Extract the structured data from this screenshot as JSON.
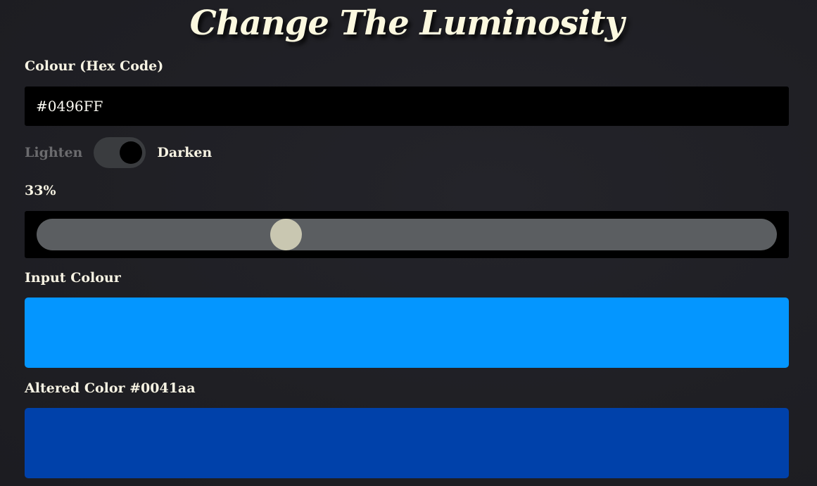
{
  "title": "Change The Luminosity",
  "hex_field": {
    "label": "Colour (Hex Code)",
    "value": "#0496FF"
  },
  "mode_toggle": {
    "left_label": "Lighten",
    "right_label": "Darken",
    "selected": "Darken"
  },
  "amount": {
    "label": "33%",
    "value_percent": 33
  },
  "input_swatch": {
    "label": "Input Colour",
    "color": "#0496FF"
  },
  "altered_swatch": {
    "label": "Altered Color #0041aa",
    "color": "#0041aa"
  },
  "colors": {
    "background": "#1f1f24",
    "text": "#f7f3e3",
    "inactive_text": "#6b6b6e",
    "slider_track": "#5b5e61",
    "slider_thumb": "#c9c7b1",
    "toggle_track": "#3a3c3f"
  }
}
